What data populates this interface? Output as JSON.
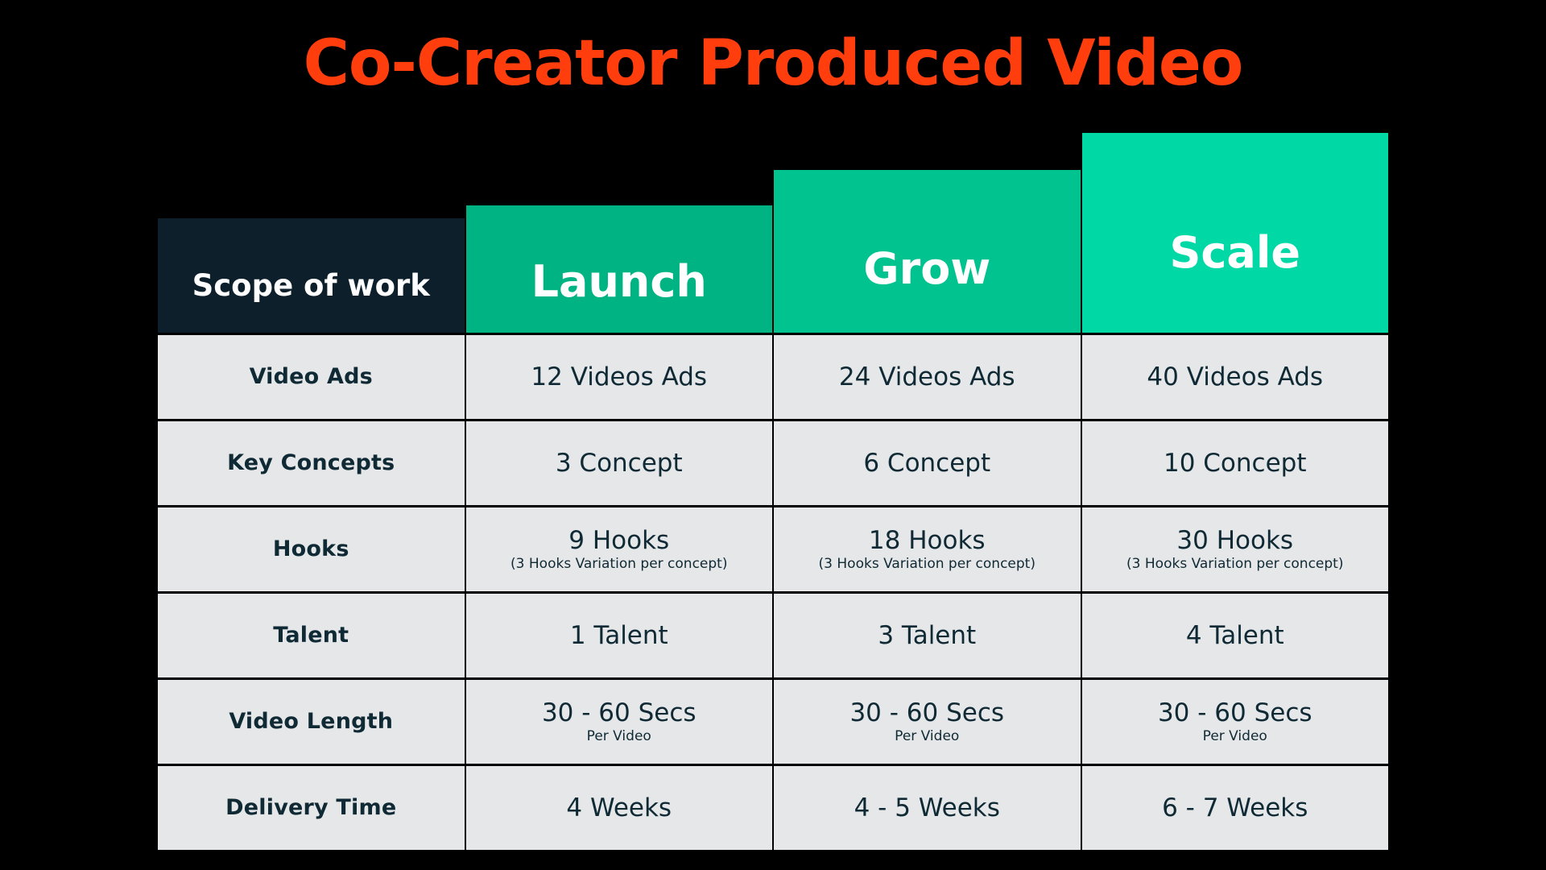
{
  "page": {
    "background_color": "#000000",
    "title": "Co-Creator Produced Video",
    "title_color": "#FF3D0D"
  },
  "table": {
    "header": {
      "scope_label": "Scope of work",
      "scope_color": "#0C1F2B",
      "plans": [
        {
          "name": "Launch",
          "color": "#00B383"
        },
        {
          "name": "Grow",
          "color": "#00C38F"
        },
        {
          "name": "Scale",
          "color": "#00D9A6"
        }
      ]
    },
    "row_background": "#E6E7E8",
    "text_color": "#102A35",
    "rows": [
      {
        "label": "Video Ads",
        "launch": {
          "main": "12 Videos Ads",
          "sub": ""
        },
        "grow": {
          "main": "24 Videos Ads",
          "sub": ""
        },
        "scale": {
          "main": "40 Videos Ads",
          "sub": ""
        }
      },
      {
        "label": "Key Concepts",
        "launch": {
          "main": "3 Concept",
          "sub": ""
        },
        "grow": {
          "main": "6 Concept",
          "sub": ""
        },
        "scale": {
          "main": "10 Concept",
          "sub": ""
        }
      },
      {
        "label": "Hooks",
        "launch": {
          "main": "9 Hooks",
          "sub": "(3 Hooks Variation per concept)"
        },
        "grow": {
          "main": "18 Hooks",
          "sub": "(3 Hooks Variation per concept)"
        },
        "scale": {
          "main": "30 Hooks",
          "sub": "(3 Hooks Variation per concept)"
        }
      },
      {
        "label": "Talent",
        "launch": {
          "main": "1 Talent",
          "sub": ""
        },
        "grow": {
          "main": "3 Talent",
          "sub": ""
        },
        "scale": {
          "main": "4 Talent",
          "sub": ""
        }
      },
      {
        "label": "Video Length",
        "launch": {
          "main": "30 - 60 Secs",
          "sub": "Per Video"
        },
        "grow": {
          "main": "30 - 60 Secs",
          "sub": "Per Video"
        },
        "scale": {
          "main": "30 - 60 Secs",
          "sub": "Per Video"
        }
      },
      {
        "label": "Delivery Time",
        "launch": {
          "main": "4 Weeks",
          "sub": ""
        },
        "grow": {
          "main": "4 - 5 Weeks",
          "sub": ""
        },
        "scale": {
          "main": "6 - 7 Weeks",
          "sub": ""
        }
      }
    ]
  }
}
